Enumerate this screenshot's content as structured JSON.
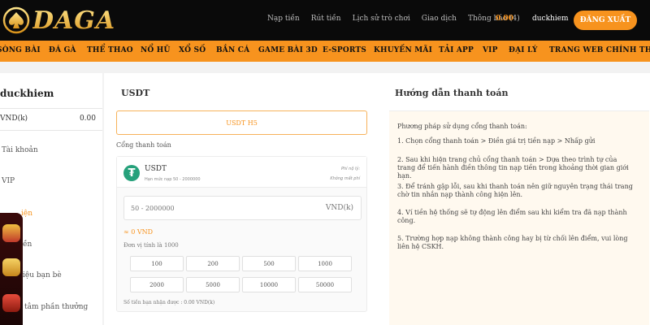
{
  "brand": {
    "logo_text": "DAGA",
    "accent": "#f7931e",
    "header_bg": "#0a0a0a"
  },
  "header": {
    "links": [
      "Nạp tiền",
      "Rút tiền",
      "Lịch sử trò chơi",
      "Giao dịch",
      "Thông báo (4)"
    ],
    "balance": "0.00",
    "username": "duckhiem",
    "logout_label": "ĐĂNG XUẤT"
  },
  "main_nav": {
    "items": [
      "SÒNG BÀI",
      "ĐÁ GÀ",
      "THỂ THAO",
      "NỔ HŨ",
      "XỔ SỐ",
      "BẮN CÁ",
      "GAME BÀI 3D",
      "E-SPORTS",
      "KHUYẾN MÃI",
      "TẢI APP",
      "VIP",
      "ĐẠI LÝ",
      "TRANG WEB CHÍNH THỨC"
    ]
  },
  "sidebar": {
    "username": "duckhiem",
    "currency": "VND(k)",
    "amount": "0.00",
    "items": [
      "Tài khoản",
      "VIP",
      "iện",
      "ền",
      "iệu bạn bè",
      "tâm phần thưởng"
    ]
  },
  "payment": {
    "title": "USDT",
    "method_button": "USDT H5",
    "gateway_label": "Cổng thanh toán",
    "gateway": {
      "name": "USDT",
      "limit": "Hạn mức nạp 50 - 2000000",
      "fee_label": "Phí nộ lý:",
      "fee_value": "Không mất phí",
      "icon": "tether-icon"
    },
    "amount_placeholder": "50 - 2000000",
    "amount_unit": "VND(k)",
    "converted": "≈ 0 VND",
    "unit_note": "Đơn vị tính là 1000",
    "presets": [
      "100",
      "200",
      "500",
      "1000",
      "2000",
      "5000",
      "10000",
      "50000"
    ],
    "received_note": "Số tiền bạn nhận được : 0.00 VND(k)"
  },
  "guide": {
    "title": "Hướng dẫn thanh toán",
    "paragraphs": [
      "Phương pháp sử dụng cổng thanh toán:",
      "1. Chọn cổng thanh toán > Điền giá trị tiền nạp > Nhấp gửi",
      "2. Sau khi hiện trang chủ cổng thanh toán > Dựa theo trình tự của trang để tiến hành điền thông tin nạp tiền trong khoảng thời gian giới hạn.",
      "3. Để tránh gặp lỗi, sau khi thanh toán nên giữ nguyên trạng thái trang chờ tin nhắn nạp thành công hiện lên.",
      "4. Ví tiền hệ thống sẽ tự động lên điểm sau khi kiểm tra đã nạp thành công.",
      "5. Trường hợp nạp không thành công hay bị từ chối lên điểm, vui lòng liên hệ CSKH."
    ]
  }
}
